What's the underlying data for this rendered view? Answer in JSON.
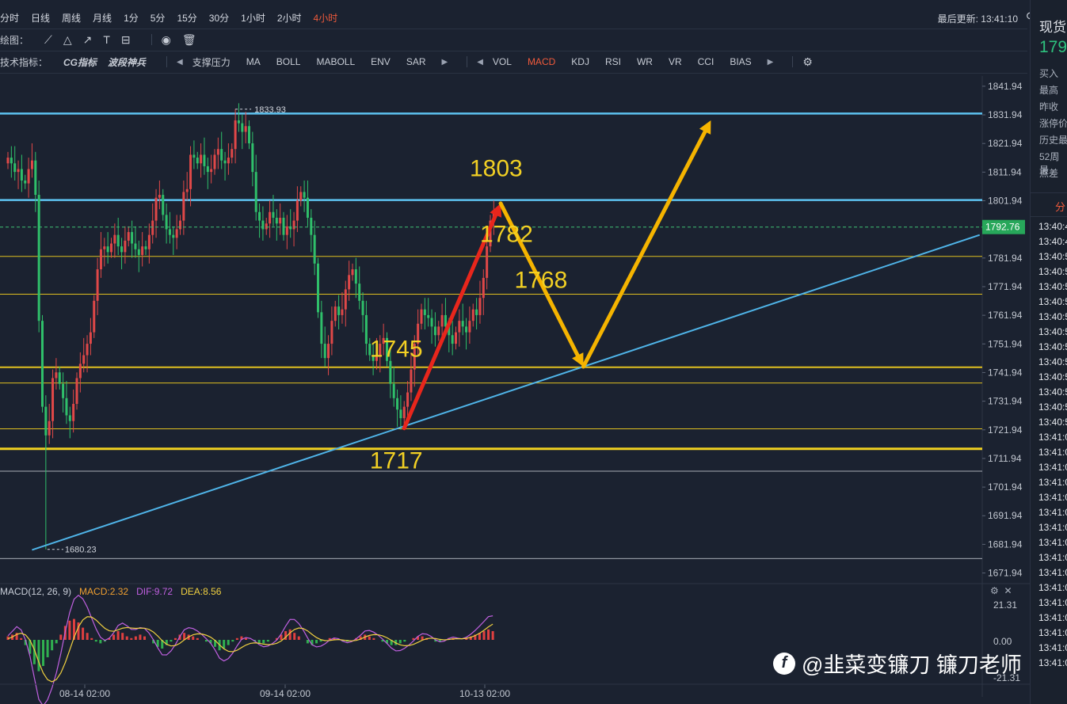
{
  "toolbar": {
    "timeframes": [
      "分时",
      "日线",
      "周线",
      "月线",
      "1分",
      "5分",
      "15分",
      "30分",
      "1小时",
      "2小时",
      "4小时"
    ],
    "active_timeframe": "4小时",
    "draw_label": "绘图：",
    "draw_tools": [
      "line-tool-icon",
      "triangle-tool-icon",
      "arrow-tool-icon",
      "text-tool-icon",
      "measure-tool-icon",
      "eye-icon",
      "trash-icon"
    ],
    "indicator_label": "技术指标：",
    "special_indicators": [
      "CG指标",
      "波段神兵"
    ],
    "main_indicators": [
      "支撑压力",
      "MA",
      "BOLL",
      "MABOLL",
      "ENV",
      "SAR"
    ],
    "sub_indicators": [
      "VOL",
      "MACD",
      "KDJ",
      "RSI",
      "WR",
      "VR",
      "CCI",
      "BIAS"
    ],
    "active_sub": "MACD",
    "last_update_label": "最后更新: 13:41:10",
    "settings_icon": "gear-icon",
    "refresh_icon": "refresh-icon",
    "fullscreen_icon": "fullscreen-icon"
  },
  "sidebar": {
    "title": "现货",
    "price": "179",
    "labels": [
      "买入",
      "最高",
      "昨收",
      "涨停价",
      "历史最",
      "52周最",
      "点差"
    ],
    "tab": "分",
    "times": [
      "13:40:4",
      "13:40:4",
      "13:40:5",
      "13:40:5",
      "13:40:5",
      "13:40:5",
      "13:40:5",
      "13:40:5",
      "13:40:5",
      "13:40:5",
      "13:40:5",
      "13:40:5",
      "13:40:5",
      "13:40:5",
      "13:41:0",
      "13:41:0",
      "13:41:0",
      "13:41:0",
      "13:41:0",
      "13:41:0",
      "13:41:0",
      "13:41:0",
      "13:41:0",
      "13:41:0",
      "13:41:0",
      "13:41:0",
      "13:41:0",
      "13:41:0",
      "13:41:0",
      "13:41:0"
    ]
  },
  "macd": {
    "name": "MACD(12, 26, 9)",
    "macd": "MACD:2.32",
    "dif": "DIF:9.72",
    "dea": "DEA:8.56",
    "y_ticks": [
      "21.31",
      "0.00",
      "-21.31"
    ],
    "colors": {
      "macd": "#f0a030",
      "dif": "#c060e0",
      "dea": "#f0d040",
      "up": "#e04040",
      "down": "#30b050"
    }
  },
  "watermark": "@韭菜变镰刀 镰刀老师",
  "watermark_logo": "f",
  "chart_data": {
    "type": "candlestick",
    "x_tick_labels": [
      "08-14 02:00",
      "09-14 02:00",
      "10-13 02:00"
    ],
    "y_tick_labels": [
      "1841.94",
      "1831.94",
      "1821.94",
      "1811.94",
      "1801.94",
      "1791.94",
      "1781.94",
      "1771.94",
      "1761.94",
      "1751.94",
      "1741.94",
      "1731.94",
      "1721.94",
      "1711.94",
      "1701.94",
      "1691.94",
      "1681.94",
      "1671.94"
    ],
    "ylim": [
      1668.5,
      1845.5
    ],
    "current_price": "1792.76",
    "annotations": {
      "high": "1833.93",
      "low": "1680.23"
    },
    "blue_horizontal_lines": [
      1832.4,
      1802.2
    ],
    "yellow_horizontal_lines": [
      1782.5,
      1769.3,
      1743.8,
      1738.3,
      1722.3
    ],
    "thick_yellow_line": 1715.3,
    "white_horizontal_lines": [
      1707.5,
      1677.0
    ],
    "price_labels": [
      {
        "text": "1803",
        "x_index": 140,
        "y": 1810.5
      },
      {
        "text": "1782",
        "x_index": 143,
        "y": 1787.5
      },
      {
        "text": "1768",
        "x_index": 153,
        "y": 1771.5
      },
      {
        "text": "1745",
        "x_index": 111,
        "y": 1747.5
      },
      {
        "text": "1717",
        "x_index": 111,
        "y": 1708.5
      }
    ],
    "arrows": [
      {
        "color": "#e8261c",
        "from": [
          115,
          1722.5
        ],
        "to": [
          143,
          1801
        ]
      },
      {
        "color": "#f5b400",
        "from": [
          143,
          1801
        ],
        "to": [
          167,
          1744
        ]
      },
      {
        "color": "#f5b400",
        "from": [
          167,
          1744
        ],
        "to": [
          204,
          1830
        ]
      }
    ],
    "trendline": {
      "color": "#4fb4e8",
      "from": [
        7,
        1680
      ],
      "to": [
        282,
        1790
      ]
    },
    "series_close": [
      1817,
      1815,
      1812,
      1813,
      1809,
      1808,
      1813,
      1816,
      1804,
      1760,
      1730,
      1720,
      1725,
      1740,
      1742,
      1738,
      1733,
      1727,
      1725,
      1731,
      1740,
      1745,
      1748,
      1752,
      1756,
      1767,
      1778,
      1785,
      1786,
      1784,
      1787,
      1790,
      1786,
      1784,
      1788,
      1791,
      1787,
      1785,
      1783,
      1786,
      1785,
      1790,
      1795,
      1803,
      1804,
      1797,
      1792,
      1790,
      1789,
      1792,
      1795,
      1805,
      1806,
      1818,
      1817,
      1815,
      1818,
      1814,
      1812,
      1813,
      1818,
      1820,
      1816,
      1815,
      1817,
      1820,
      1830,
      1829,
      1826,
      1828,
      1822,
      1812,
      1798,
      1795,
      1792,
      1794,
      1798,
      1796,
      1794,
      1796,
      1790,
      1793,
      1792,
      1795,
      1802,
      1805,
      1803,
      1796,
      1790,
      1780,
      1763,
      1752,
      1747,
      1752,
      1760,
      1765,
      1762,
      1764,
      1771,
      1776,
      1778,
      1773,
      1767,
      1762,
      1752,
      1748,
      1746,
      1748,
      1752,
      1754,
      1746,
      1738,
      1733,
      1729,
      1726,
      1730,
      1735,
      1743,
      1752,
      1759,
      1764,
      1762,
      1761,
      1758,
      1755,
      1758,
      1762,
      1758,
      1755,
      1752,
      1756,
      1760,
      1758,
      1756,
      1760,
      1764,
      1762,
      1768,
      1775,
      1786,
      1795,
      1798
    ],
    "macd_hist": [
      2,
      3,
      4,
      1,
      -3,
      -8,
      -14,
      -18,
      -15,
      -10,
      -6,
      -2,
      3,
      8,
      11,
      12,
      10,
      7,
      4,
      1,
      -1,
      -2,
      -1,
      1,
      3,
      5,
      4,
      2,
      1,
      2,
      3,
      2,
      0,
      -2,
      -4,
      -5,
      -3,
      -1,
      1,
      3,
      4,
      3,
      2,
      1,
      0,
      -1,
      -2,
      -4,
      -6,
      -5,
      -3,
      -1,
      1,
      2,
      1,
      0,
      -1,
      -2,
      -2,
      -1,
      0,
      1,
      3,
      5,
      6,
      4,
      2,
      0,
      -2,
      -3,
      -2,
      -1,
      0,
      1,
      1,
      0,
      -1,
      -1,
      0,
      1,
      2,
      3,
      2,
      1,
      0,
      -1,
      -2,
      -3,
      -3,
      -2,
      -1,
      0,
      1,
      2,
      2,
      1,
      0,
      -1,
      -1,
      0,
      1,
      1,
      0,
      0,
      1,
      2,
      3,
      4,
      5,
      6,
      5
    ]
  }
}
